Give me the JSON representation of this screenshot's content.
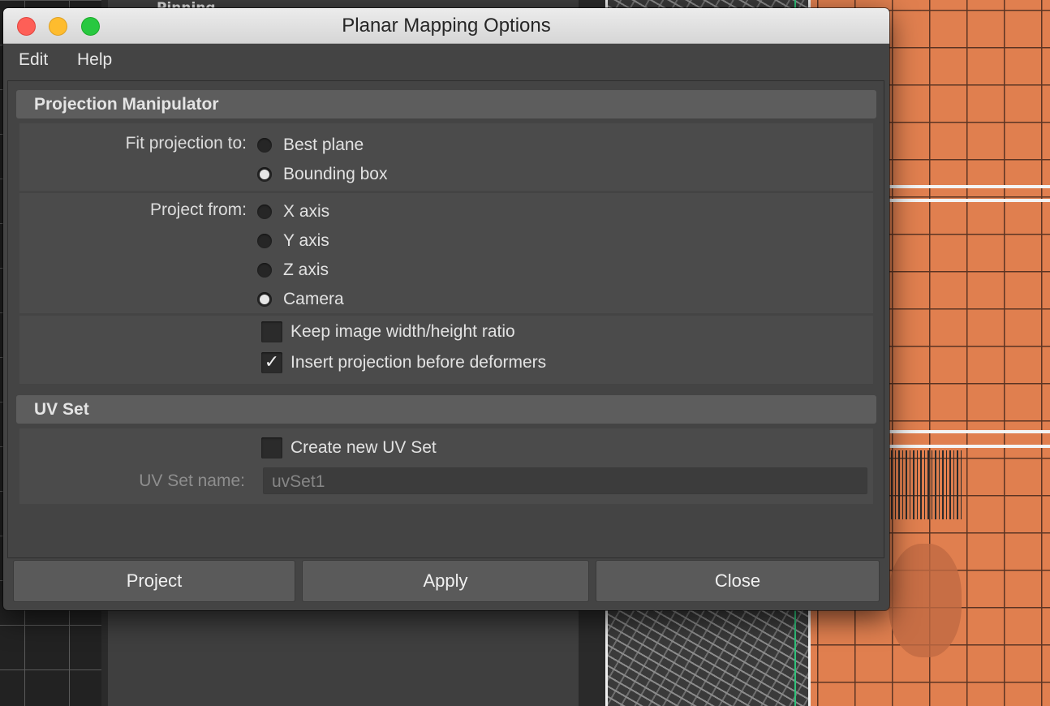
{
  "window": {
    "title": "Planar Mapping Options"
  },
  "menu": {
    "items": [
      "Edit",
      "Help"
    ]
  },
  "background": {
    "outliner_row": "Pinning"
  },
  "projection_manipulator": {
    "header": "Projection Manipulator",
    "fit_label": "Fit projection to:",
    "fit_options": [
      {
        "label": "Best plane",
        "selected": false
      },
      {
        "label": "Bounding box",
        "selected": true
      }
    ],
    "project_label": "Project from:",
    "project_options": [
      {
        "label": "X axis",
        "selected": false
      },
      {
        "label": "Y axis",
        "selected": false
      },
      {
        "label": "Z axis",
        "selected": false
      },
      {
        "label": "Camera",
        "selected": true
      }
    ],
    "checkboxes": [
      {
        "label": "Keep image width/height ratio",
        "checked": false
      },
      {
        "label": "Insert projection before deformers",
        "checked": true
      }
    ]
  },
  "uv_set": {
    "header": "UV Set",
    "create_label": "Create new UV Set",
    "create_checked": false,
    "name_label": "UV Set name:",
    "name_value": "uvSet1"
  },
  "buttons": {
    "project": "Project",
    "apply": "Apply",
    "close": "Close"
  },
  "icons": {
    "check_glyph": "✓"
  },
  "colors": {
    "dialog_bg": "#444444",
    "section_header": "#5d5d5d",
    "group_bg": "#4b4b4b",
    "close_traffic": "#fe5f57",
    "minimize_traffic": "#febc2e",
    "zoom_traffic": "#28c840",
    "viewport_orange": "#e07f4f"
  }
}
